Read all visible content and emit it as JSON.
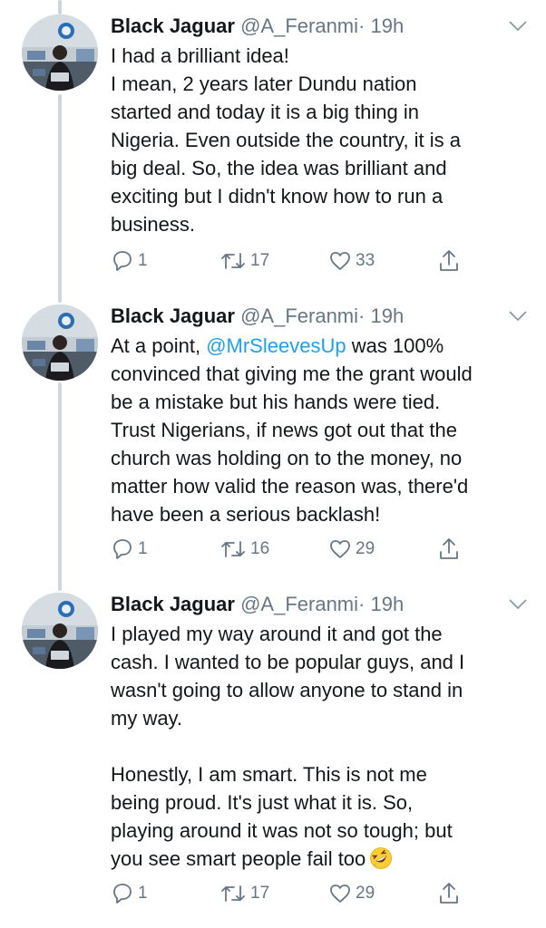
{
  "tweets": [
    {
      "name": "Black Jaguar",
      "handle": "@A_Feranmi",
      "separator": "·",
      "time": "19h",
      "paragraphs": [
        [
          "I had a brilliant idea!"
        ],
        [
          "I mean, 2 years later Dundu nation",
          "started and today it is a big thing in",
          "Nigeria. Even outside the country, it is a",
          "big deal. So, the idea was brilliant and",
          "exciting but I didn't know how to run a",
          "business."
        ]
      ],
      "replies": "1",
      "retweets": "17",
      "likes": "33"
    },
    {
      "name": "Black Jaguar",
      "handle": "@A_Feranmi",
      "separator": "·",
      "time": "19h",
      "lead": "At a point, ",
      "mention": "@MrSleevesUp",
      "after_mention": " was 100%",
      "lines": [
        "convinced that giving me the grant would",
        "be a mistake but his hands were tied.",
        "Trust Nigerians, if news got out that the",
        "church was holding on to the money, no",
        "matter how valid the reason was, there'd",
        "have been a serious backlash!"
      ],
      "replies": "1",
      "retweets": "16",
      "likes": "29"
    },
    {
      "name": "Black Jaguar",
      "handle": "@A_Feranmi",
      "separator": "·",
      "time": "19h",
      "lines_a": [
        "I played my way around it and got the",
        "cash. I wanted to be popular guys, and I",
        "wasn't going to allow anyone to stand in",
        "my way."
      ],
      "lines_b": [
        "Honestly, I am smart. This is not me",
        "being proud. It's just what it is. So,",
        "playing around it was not so tough; but",
        "you see smart people fail too"
      ],
      "emoji": "rolling-on-floor-laughing",
      "replies": "1",
      "retweets": "17",
      "likes": "29"
    }
  ],
  "colors": {
    "link": "#1da1f2",
    "muted": "#657786",
    "text": "#14171a",
    "thread": "#ccd6dd"
  }
}
